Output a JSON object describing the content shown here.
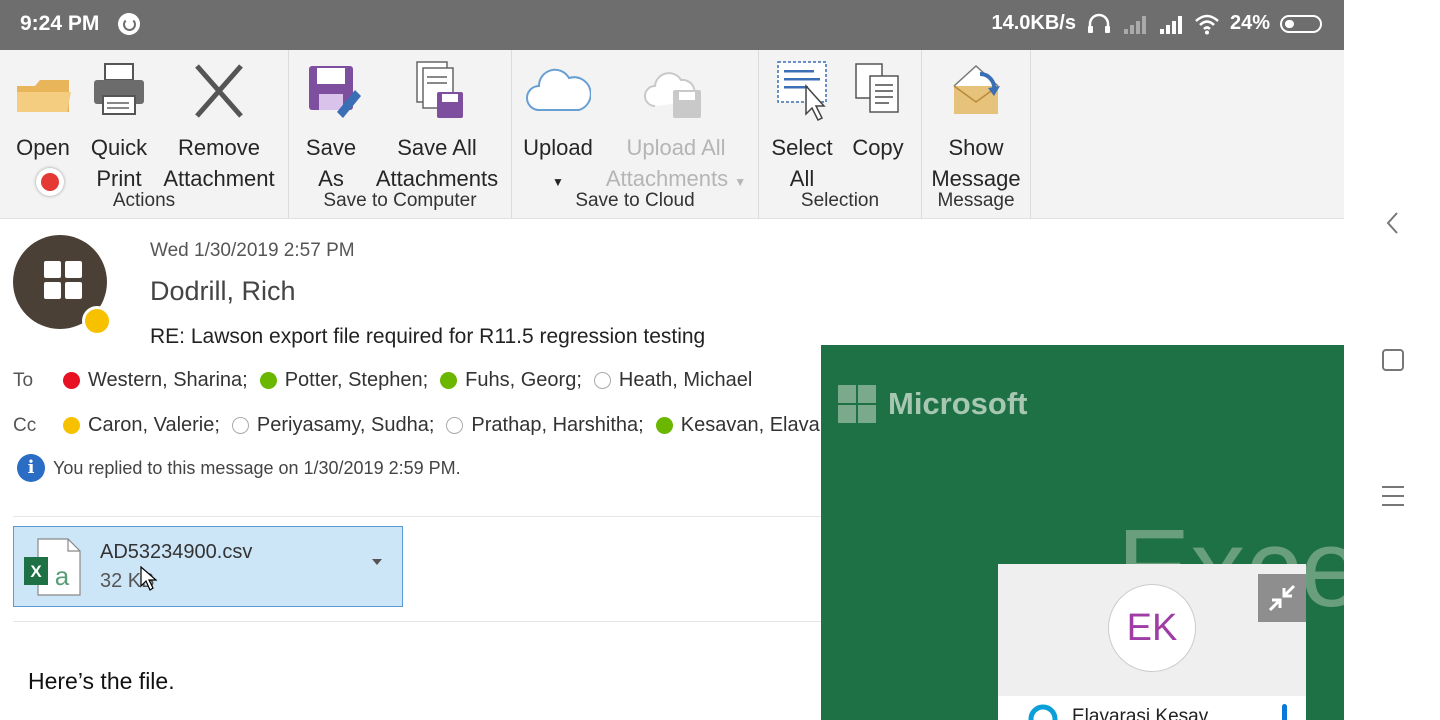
{
  "status_bar": {
    "time": "9:24 PM",
    "network_speed": "14.0KB/s",
    "battery": "24%"
  },
  "ribbon": {
    "groups": [
      {
        "label": "Actions",
        "buttons": [
          {
            "line1": "Open",
            "line2": "",
            "icon": "folder-icon"
          },
          {
            "line1": "Quick",
            "line2": "Print",
            "icon": "printer-icon"
          },
          {
            "line1": "Remove",
            "line2": "Attachment",
            "icon": "x-icon"
          }
        ]
      },
      {
        "label": "Save to Computer",
        "buttons": [
          {
            "line1": "Save",
            "line2": "As",
            "icon": "save-icon"
          },
          {
            "line1": "Save All",
            "line2": "Attachments",
            "icon": "save-all-icon"
          }
        ]
      },
      {
        "label": "Save to Cloud",
        "buttons": [
          {
            "line1": "Upload",
            "line2": "",
            "icon": "cloud-icon",
            "dropdown": true
          },
          {
            "line1": "Upload All",
            "line2": "Attachments",
            "icon": "cloud-save-icon",
            "disabled": true,
            "dropdown": true
          }
        ]
      },
      {
        "label": "Selection",
        "buttons": [
          {
            "line1": "Select",
            "line2": "All",
            "icon": "select-all-icon"
          },
          {
            "line1": "Copy",
            "line2": "",
            "icon": "copy-icon"
          }
        ]
      },
      {
        "label": "Message",
        "buttons": [
          {
            "line1": "Show",
            "line2": "Message",
            "icon": "envelope-icon"
          }
        ]
      }
    ]
  },
  "message": {
    "date": "Wed 1/30/2019 2:57 PM",
    "sender": "Dodrill, Rich",
    "subject": "RE: Lawson export file required for R11.5 regression testing",
    "to_label": "To",
    "cc_label": "Cc",
    "to": [
      {
        "name": "Western, Sharina;",
        "status": "busy"
      },
      {
        "name": "Potter, Stephen;",
        "status": "available"
      },
      {
        "name": "Fuhs, Georg;",
        "status": "available"
      },
      {
        "name": "Heath, Michael",
        "status": "offline"
      }
    ],
    "cc": [
      {
        "name": "Caron, Valerie;",
        "status": "away"
      },
      {
        "name": "Periyasamy, Sudha;",
        "status": "offline"
      },
      {
        "name": "Prathap, Harshitha;",
        "status": "offline"
      },
      {
        "name": "Kesavan, Elava",
        "status": "available"
      }
    ],
    "info": "You replied to this message on 1/30/2019 2:59 PM.",
    "attachment": {
      "name": "AD53234900.csv",
      "size": "32 KB"
    },
    "body": "Here’s the file."
  },
  "overlay": {
    "brand": "Microsoft",
    "app_name": "Excel",
    "caller_initials": "EK",
    "caller_name": "Elavarasi Kesav"
  },
  "colors": {
    "ribbon_bg": "#f3f3f3",
    "excel_green": "#1e7145",
    "attachment_bg": "#cde6f7",
    "status_busy": "#e81123",
    "status_available": "#6bb700",
    "status_away": "#f8c100"
  }
}
